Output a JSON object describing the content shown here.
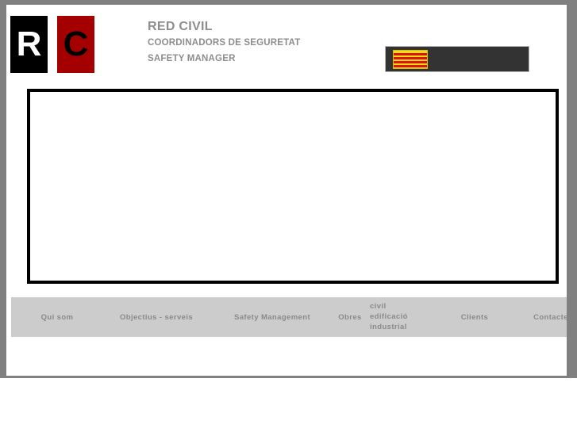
{
  "header": {
    "logo": {
      "letter_left": "R",
      "letter_right": "C",
      "color_left_bg": "#000000",
      "color_left_fg": "#ffffff",
      "color_right_bg": "#a50000",
      "color_right_fg": "#000000"
    },
    "brand_title": "RED CIVIL",
    "brand_line2": "COORDINADORS DE SEGURETAT",
    "brand_line3": "SAFETY MANAGER",
    "brand_color": "#8d8d8d",
    "flag_bar": {
      "background": "#333333",
      "flag_name": "catalan-senyera-flag",
      "flag_yellow": "#fcdd09",
      "flag_red": "#da121a",
      "stripe_count": 4
    }
  },
  "main": {
    "content_box_border_color": "#000000",
    "content_box_background": "#ffffff"
  },
  "nav": {
    "background": "#cccccc",
    "text_color": "#8a8a8a",
    "items": [
      {
        "label": "Qui som"
      },
      {
        "label": "Objectius - serveis"
      },
      {
        "label": "Safety Management"
      },
      {
        "label": "Obres"
      },
      {
        "lines": [
          "civil",
          "edificació",
          "industrial"
        ]
      },
      {
        "label": "Clients"
      },
      {
        "label": "Contacte"
      }
    ]
  },
  "page": {
    "frame_color": "#808080",
    "sheet_color": "#ffffff"
  }
}
